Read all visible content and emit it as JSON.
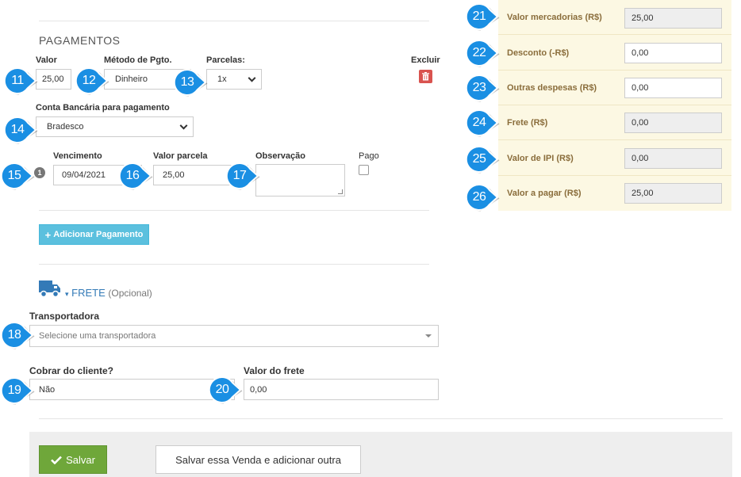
{
  "payments": {
    "section_title": "PAGAMENTOS",
    "valor_label": "Valor",
    "valor_value": "25,00",
    "metodo_label": "Método de Pgto.",
    "metodo_value": "Dinheiro",
    "parcelas_label": "Parcelas:",
    "parcelas_value": "1x",
    "excluir_label": "Excluir",
    "conta_label": "Conta Bancária para pagamento",
    "conta_value": "Bradesco",
    "installment_badge": "1",
    "vencimento_label": "Vencimento",
    "vencimento_value": "09/04/2021",
    "valor_parcela_label": "Valor parcela",
    "valor_parcela_value": "25,00",
    "observacao_label": "Observação",
    "pago_label": "Pago",
    "add_payment_label": "Adicionar Pagamento"
  },
  "frete": {
    "title": "FRETE",
    "optional": "(Opcional)",
    "transportadora_label": "Transportadora",
    "transportadora_placeholder": "Selecione uma transportadora",
    "cobrar_label": "Cobrar do cliente?",
    "cobrar_value": "Não",
    "valor_frete_label": "Valor do frete",
    "valor_frete_value": "0,00"
  },
  "totals": [
    {
      "label": "Valor mercadorias (R$)",
      "value": "25,00",
      "readonly": true
    },
    {
      "label": "Desconto (-R$)",
      "value": "0,00",
      "readonly": false
    },
    {
      "label": "Outras despesas (R$)",
      "value": "0,00",
      "readonly": false
    },
    {
      "label": "Frete (R$)",
      "value": "0,00",
      "readonly": true
    },
    {
      "label": "Valor de IPI (R$)",
      "value": "0,00",
      "readonly": true
    },
    {
      "label": "Valor a pagar (R$)",
      "value": "25,00",
      "readonly": true
    }
  ],
  "footer": {
    "save_label": "Salvar",
    "save_add_label": "Salvar essa Venda e adicionar outra"
  },
  "markers": [
    "11",
    "12",
    "13",
    "14",
    "15",
    "16",
    "17",
    "18",
    "19",
    "20",
    "21",
    "22",
    "23",
    "24",
    "25",
    "26"
  ],
  "colors": {
    "marker": "#1a8fe3",
    "add_button": "#5bc0de",
    "save_button": "#6fa73a",
    "delete_button": "#d9534f",
    "summary_panel": "#fcf8e3",
    "link": "#337ab7"
  },
  "icons": {
    "delete": "trash-icon",
    "truck": "truck-icon",
    "check": "check-icon",
    "plus": "plus-icon",
    "dropdown": "chevron-down-icon"
  }
}
